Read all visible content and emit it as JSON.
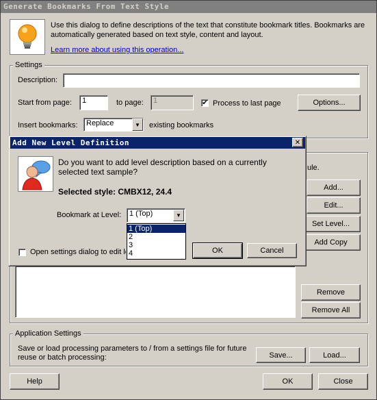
{
  "window": {
    "title": "Generate Bookmarks From Text Style"
  },
  "intro": {
    "text": "Use this dialog to define descriptions of the text that constitute bookmark titles. Bookmarks are automatically generated based on text style, content and layout.",
    "link": "Learn more about using this operation..."
  },
  "settings": {
    "legend": "Settings",
    "description_label": "Description:",
    "description_value": "",
    "start_label": "Start from page:",
    "start_value": "1",
    "to_label": "to page:",
    "to_value": "1",
    "process_last_label": "Process to last page",
    "process_last_checked": "✔",
    "options_button": "Options...",
    "insert_label": "Insert bookmarks:",
    "insert_value": "Replace",
    "existing_label": "existing bookmarks"
  },
  "levels": {
    "partial_text": "ule.",
    "add_button": "Add...",
    "edit_button": "Edit...",
    "set_level_button": "Set Level...",
    "add_copy_button": "Add Copy",
    "remove_button": "Remove",
    "remove_all_button": "Remove All"
  },
  "app_settings": {
    "legend": "Application Settings",
    "text": "Save or load processing parameters to / from a settings file for future reuse or batch processing:",
    "save_button": "Save...",
    "load_button": "Load..."
  },
  "footer": {
    "help": "Help",
    "ok": "OK",
    "close": "Close"
  },
  "modal": {
    "title": "Add New Level Definition",
    "question": "Do you want to add level description based on a currently selected text sample?",
    "style_label": "Selected style: CMBX12, 24.4",
    "bookmark_label": "Bookmark at Level:",
    "level_value": "1 (Top)",
    "level_options": [
      "1 (Top)",
      "2",
      "3",
      "4"
    ],
    "open_settings_label": "Open settings dialog to edit le",
    "ok": "OK",
    "cancel": "Cancel",
    "close_glyph": "✕"
  }
}
